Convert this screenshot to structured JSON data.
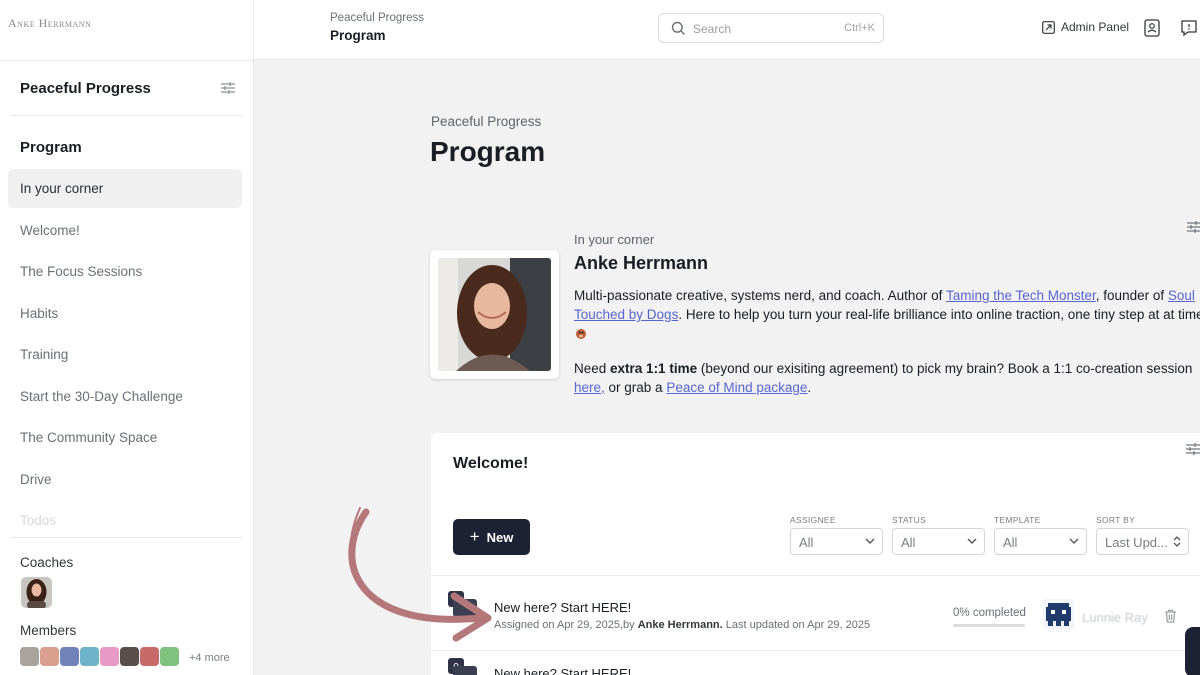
{
  "sidebar": {
    "logo_text": "Anke Herrmann",
    "space_name": "Peaceful Progress",
    "section_heading": "Program",
    "nav_items": [
      {
        "label": "In your corner"
      },
      {
        "label": "Welcome!"
      },
      {
        "label": "The Focus Sessions"
      },
      {
        "label": "Habits"
      },
      {
        "label": "Training"
      },
      {
        "label": "Start the 30-Day Challenge"
      },
      {
        "label": "The Community Space"
      },
      {
        "label": "Drive"
      },
      {
        "label": "Todos"
      }
    ],
    "coaches_label": "Coaches",
    "members_label": "Members",
    "members_more": "+4 more"
  },
  "topbar": {
    "crumb_parent": "Peaceful Progress",
    "crumb_current": "Program",
    "search_placeholder": "Search",
    "search_shortcut": "Ctrl+K",
    "admin_label": "Admin Panel"
  },
  "main": {
    "subtitle": "Peaceful Progress",
    "title": "Program",
    "corner_card": {
      "label": "In your corner",
      "name": "Anke Herrmann",
      "bio_part1": "Multi-passionate creative, systems nerd, and coach. Author of ",
      "bio_link1": "Taming the Tech Monster",
      "bio_part2": ", founder of ",
      "bio_link2": "Soul Touched by Dogs",
      "bio_part3": ". Here to help you turn your real-life brilliance into online traction, one tiny step at at time",
      "need_part1": "Need ",
      "need_bold": "extra 1:1 time",
      "need_part2": " (beyond our exisiting agreement) to pick my brain? Book a 1:1 co-creation session ",
      "need_link1": "here,",
      "need_part3": " or grab a ",
      "need_link2": "Peace of Mind package",
      "need_part4": "."
    },
    "welcome_card": {
      "title": "Welcome!",
      "new_button": "New",
      "filters": [
        {
          "label": "ASSIGNEE",
          "value": "All"
        },
        {
          "label": "STATUS",
          "value": "All"
        },
        {
          "label": "TEMPLATE",
          "value": "All"
        },
        {
          "label": "SORT BY",
          "value": "Last Upd..."
        }
      ],
      "tasks": [
        {
          "badge": "0",
          "title": "New here? Start HERE!",
          "meta_prefix": "Assigned on Apr 29, 2025,by ",
          "meta_author": "Anke Herrmann.",
          "meta_suffix": " Last updated on Apr 29, 2025",
          "progress_label": "0% completed",
          "progress": 0,
          "assignee": "Lunnie Ray"
        },
        {
          "badge": "0",
          "title": "New here? Start HERE!"
        }
      ]
    }
  },
  "colors": {
    "accent": "#5865d0",
    "dark_button": "#1c2233",
    "annotation_arrow": "#b5787a"
  }
}
